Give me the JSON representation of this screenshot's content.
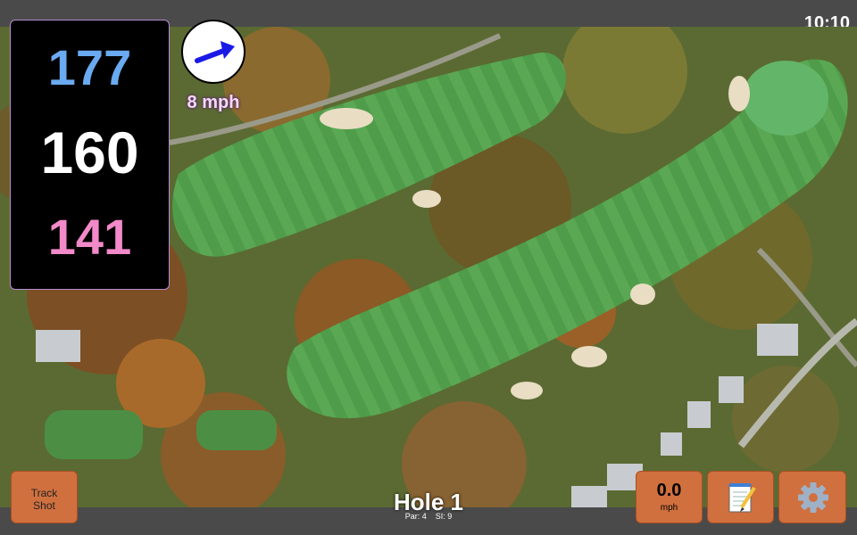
{
  "status_bar": {
    "time": "10:10"
  },
  "yardages": {
    "back": "177",
    "center": "160",
    "front": "141",
    "colors": {
      "back": "#6aaaf0",
      "center": "#ffffff",
      "front": "#f289c9"
    }
  },
  "wind": {
    "speed_label": "8 mph",
    "icon": "wind-direction-arrow-icon",
    "arrow_color": "#1a1ae6"
  },
  "buttons": {
    "track_shot_line1": "Track",
    "track_shot_line2": "Shot",
    "speed_value": "0.0",
    "speed_unit": "mph",
    "notes_icon": "notepad-icon",
    "settings_icon": "gear-icon",
    "accent_color": "#d0703f"
  },
  "hole": {
    "title": "Hole 1",
    "par_label": "Par: 4",
    "si_label": "SI: 9"
  }
}
